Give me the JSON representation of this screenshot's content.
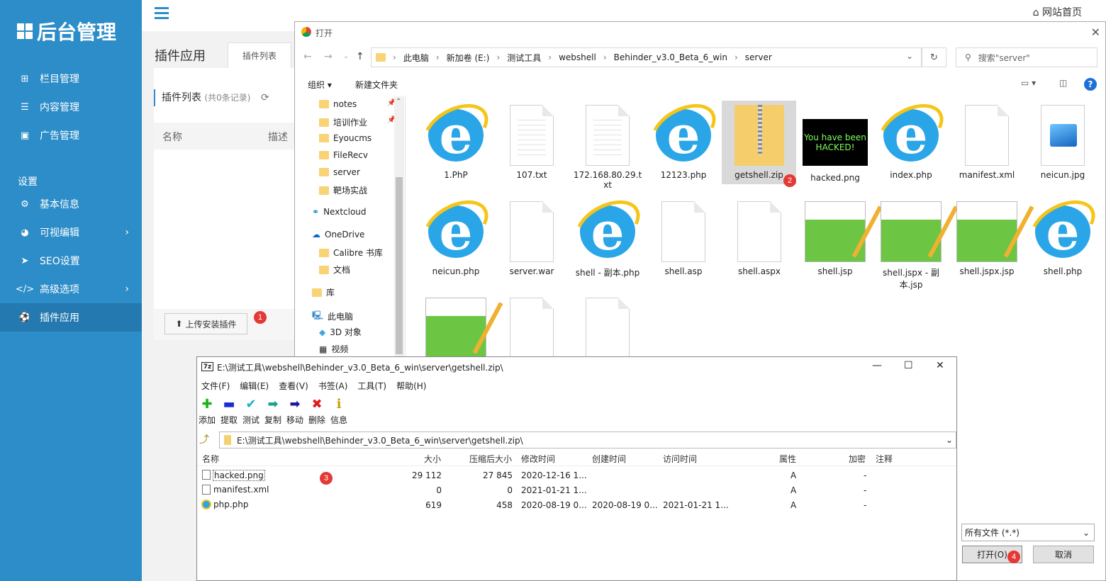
{
  "admin": {
    "logo": "后台管理",
    "nav": [
      "栏目管理",
      "内容管理",
      "广告管理"
    ],
    "section": "设置",
    "nav2": [
      "基本信息",
      "可视编辑",
      "SEO设置",
      "高级选项",
      "插件应用"
    ],
    "home": "网站首页",
    "page_title": "插件应用",
    "tab": "插件列表",
    "list_title": "插件列表",
    "record_count": "(共0条记录)",
    "col_name": "名称",
    "col_desc": "描述",
    "upload": "上传安装插件"
  },
  "markers": [
    "1",
    "2",
    "3",
    "4"
  ],
  "open_dialog": {
    "title": "打开",
    "breadcrumb": [
      "此电脑",
      "新加卷 (E:)",
      "测试工具",
      "webshell",
      "Behinder_v3.0_Beta_6_win",
      "server"
    ],
    "search_placeholder": "搜索\"server\"",
    "organize": "组织 ▾",
    "new_folder": "新建文件夹",
    "tree": [
      "notes",
      "培训作业",
      "Eyoucms",
      "FileRecv",
      "server",
      "靶场实战",
      "Nextcloud",
      "OneDrive",
      "Calibre 书库",
      "文档",
      "库",
      "此电脑",
      "3D 对象",
      "视频"
    ],
    "files": [
      "1.PhP",
      "107.txt",
      "172.168.80.29.txt",
      "12123.php",
      "getshell.zip",
      "hacked.png",
      "index.php",
      "manifest.xml",
      "neicun.jpg",
      "neicun.php",
      "server.war",
      "shell - 副本.php",
      "shell.asp",
      "shell.aspx",
      "shell.jsp",
      "shell.jspx - 副本.jsp",
      "shell.jspx.jsp",
      "shell.php"
    ],
    "file_type": "所有文件 (*.*)",
    "open": "打开(O)",
    "cancel": "取消",
    "png_text": [
      "You have been",
      "HACKED!"
    ]
  },
  "zip": {
    "title": "E:\\测试工具\\webshell\\Behinder_v3.0_Beta_6_win\\server\\getshell.zip\\",
    "menu": [
      "文件(F)",
      "编辑(E)",
      "查看(V)",
      "书签(A)",
      "工具(T)",
      "帮助(H)"
    ],
    "tools": [
      "添加",
      "提取",
      "测试",
      "复制",
      "移动",
      "删除",
      "信息"
    ],
    "address": "E:\\测试工具\\webshell\\Behinder_v3.0_Beta_6_win\\server\\getshell.zip\\",
    "columns": [
      "名称",
      "大小",
      "压缩后大小",
      "修改时间",
      "创建时间",
      "访问时间",
      "属性",
      "加密",
      "注释"
    ],
    "rows": [
      {
        "name": "hacked.png",
        "size": "29 112",
        "packed": "27 845",
        "modified": "2020-12-16 1...",
        "created": "",
        "accessed": "",
        "attr": "A",
        "enc": "-"
      },
      {
        "name": "manifest.xml",
        "size": "0",
        "packed": "0",
        "modified": "2021-01-21 1...",
        "created": "",
        "accessed": "",
        "attr": "A",
        "enc": "-"
      },
      {
        "name": "php.php",
        "size": "619",
        "packed": "458",
        "modified": "2020-08-19 0...",
        "created": "2020-08-19 0...",
        "accessed": "2021-01-21 1...",
        "attr": "A",
        "enc": "-"
      }
    ]
  }
}
